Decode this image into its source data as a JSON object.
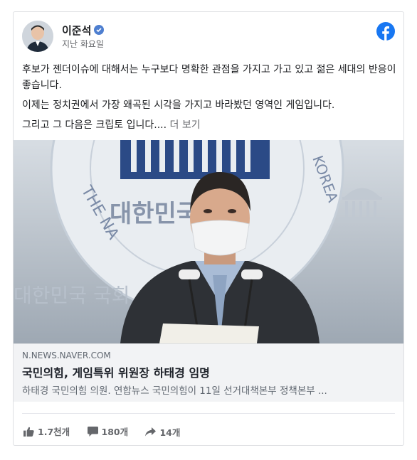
{
  "post": {
    "author": "이준석",
    "time": "지난 화요일",
    "paragraphs": [
      "후보가 젠더이슈에 대해서는 누구보다 명확한 관점을 가지고 가고 있고 젊은 세대의 반응이 좋습니다.",
      "이제는 정치권에서 가장 왜곡된 시각을 가지고 바라봤던 영역인 게임입니다.",
      "그리고 그 다음은 크립토 입니다...."
    ],
    "see_more": "더 보기"
  },
  "photo": {
    "seal_top": "THE NA",
    "seal_right": "KOREA",
    "seal_bottom": "대한민국국회",
    "back_text": "대한민국 국회"
  },
  "link": {
    "domain": "N.NEWS.NAVER.COM",
    "headline": "국민의힘, 게임특위 위원장 하태경 임명",
    "description": "하태경 국민의힘 의원. 연합뉴스 국민의힘이 11일 선거대책본부 정책본부 ..."
  },
  "stats": {
    "likes": "1.7천개",
    "comments": "180개",
    "shares": "14개"
  },
  "colors": {
    "facebook_blue": "#1877f2",
    "verified_blue": "#4e7fd0"
  },
  "icons": [
    "verified-icon",
    "facebook-logo-icon",
    "like-icon",
    "comment-icon",
    "share-icon"
  ]
}
